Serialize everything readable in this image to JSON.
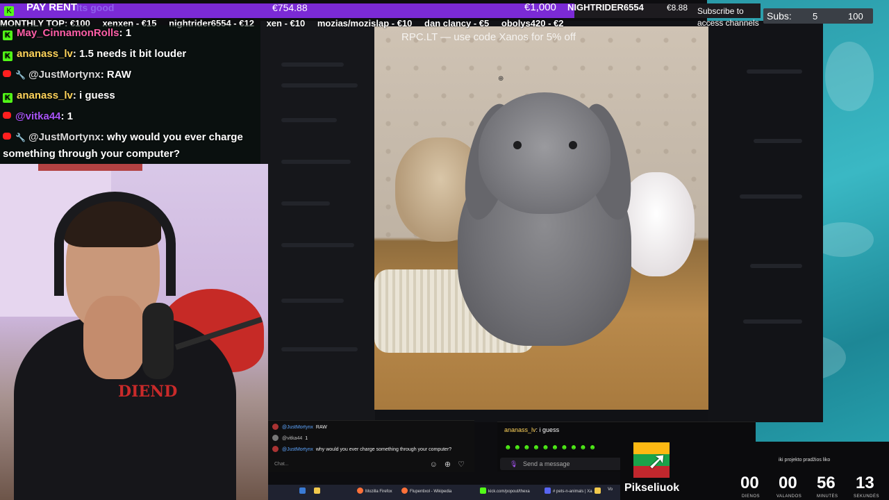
{
  "rent_bar": {
    "label": "PAY RENT",
    "value": "€754.88",
    "goal": "€1,000",
    "progress": 0.755,
    "faded_text": "Its good",
    "last_donor": "NIGHTRIDER6554",
    "last_amount": "€8.88"
  },
  "subscribe": {
    "line1": "Subscribe to",
    "line2": "access channels"
  },
  "subs": {
    "label": "Subs:",
    "count": "5",
    "goal": "100"
  },
  "monthly_top": [
    "MONTHLY TOP: €100",
    "xenxen - €15",
    "nightrider6554 - €12",
    "xen - €10",
    "mozias/mozislap - €10",
    "dan clancy - €5",
    "obolys420 - €2"
  ],
  "promo": "RPC.LT — use code Xanos for 5% off",
  "chat": [
    {
      "platform": "kick",
      "user": "May_CinnamonRolls",
      "text": ": 1",
      "color": "pink"
    },
    {
      "platform": "kick",
      "user": "ananass_lv",
      "text": ": 1.5 needs it bit louder",
      "color": "green"
    },
    {
      "platform": "yt",
      "user": "@JustMortynx",
      "text": ": RAW",
      "color": "gray"
    },
    {
      "platform": "kick",
      "user": "ananass_lv",
      "text": ": i guess",
      "color": "green"
    },
    {
      "platform": "yt",
      "user": "@vitka44",
      "text": ": 1",
      "color": "purple"
    },
    {
      "platform": "yt",
      "user": "@JustMortynx",
      "text": ": why would you ever charge",
      "color": "gray"
    },
    {
      "platform": "none",
      "user": "",
      "text": "something through your computer?",
      "color": "gray"
    }
  ],
  "webcam": {
    "shirt_text": "DIEND"
  },
  "yt_chat": {
    "lines": [
      {
        "name": "@JustMortynx",
        "text": "RAW"
      },
      {
        "name": "@vitka44",
        "text": "1"
      },
      {
        "name": "@JustMortynx",
        "text": "why would you ever charge something through your computer?"
      }
    ],
    "placeholder": "Chat..."
  },
  "kick_chat": {
    "last_user": "ananass_lv",
    "last_text": ": i guess",
    "placeholder": "Send a message"
  },
  "flag_label": "Pikseliuok",
  "timer": {
    "title": "iki projekto pradžios liko",
    "units": [
      {
        "value": "00",
        "label": "DIENOS"
      },
      {
        "value": "00",
        "label": "VALANDOS"
      },
      {
        "value": "56",
        "label": "MINUTĖS"
      },
      {
        "value": "13",
        "label": "SEKUNDĖS"
      }
    ]
  },
  "taskbar": [
    "Mozilla Firefox",
    "Flupentixol - Wikipedia",
    "kick.com/popout/thexa",
    "# pets-n-animals | Xa",
    "Vo"
  ]
}
